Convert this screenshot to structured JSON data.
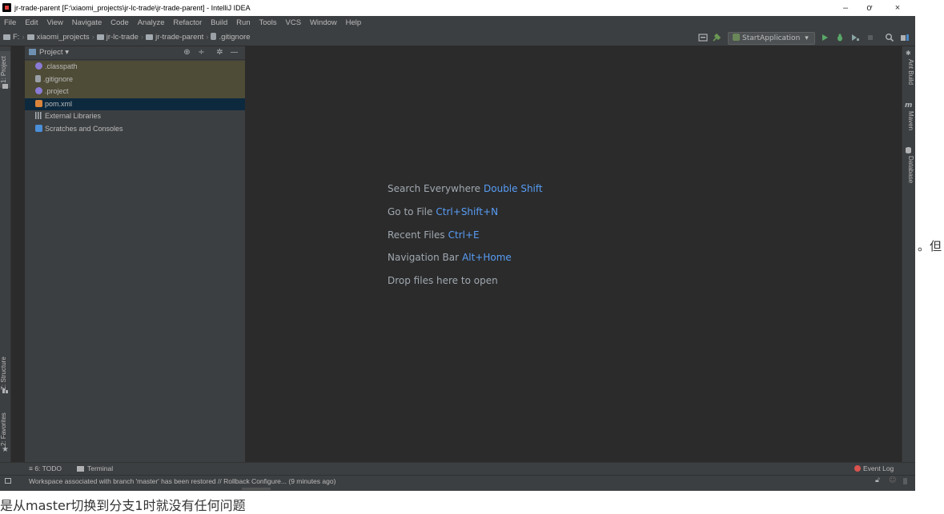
{
  "window": {
    "title": "jr-trade-parent [F:\\xiaomi_projects\\jr-lc-trade\\jr-trade-parent] - IntelliJ IDEA",
    "minimize": "–",
    "maximize": "ơ",
    "close": "×"
  },
  "menu": [
    "File",
    "Edit",
    "View",
    "Navigate",
    "Code",
    "Analyze",
    "Refactor",
    "Build",
    "Run",
    "Tools",
    "VCS",
    "Window",
    "Help"
  ],
  "breadcrumb": {
    "drive": "F:",
    "items": [
      "xiaomi_projects",
      "jr-lc-trade",
      "jr-trade-parent",
      ".gitignore"
    ]
  },
  "toolbar": {
    "run_config": "StartApplication"
  },
  "left_strip": {
    "project_tab": "1: Project",
    "structure_tab": "Z: Structure",
    "favorites_tab": "2: Favorites"
  },
  "right_strip": {
    "ant_tab": "Ant Build",
    "maven_tab": "Maven",
    "database_tab": "Database"
  },
  "project_panel": {
    "title": "Project",
    "items": [
      {
        "label": ".classpath",
        "state": "ignored",
        "icon": "classpath-file-icon",
        "color": "#8a7bd6"
      },
      {
        "label": ".gitignore",
        "state": "ignored",
        "icon": "gitignore-file-icon",
        "color": "#9aa0a6"
      },
      {
        "label": ".project",
        "state": "ignored",
        "icon": "project-file-icon",
        "color": "#8a7bd6"
      },
      {
        "label": "pom.xml",
        "state": "selected",
        "icon": "maven-pom-icon",
        "color": "#d9843a"
      },
      {
        "label": "External Libraries",
        "state": "normal",
        "icon": "libraries-icon",
        "color": "#a9b0b8"
      },
      {
        "label": "Scratches and Consoles",
        "state": "normal",
        "icon": "scratches-icon",
        "color": "#4a8fd8"
      }
    ]
  },
  "editor_hints": [
    {
      "label": "Search Everywhere",
      "shortcut": "Double Shift"
    },
    {
      "label": "Go to File",
      "shortcut": "Ctrl+Shift+N"
    },
    {
      "label": "Recent Files",
      "shortcut": "Ctrl+E"
    },
    {
      "label": "Navigation Bar",
      "shortcut": "Alt+Home"
    },
    {
      "label": "Drop files here to open",
      "shortcut": ""
    }
  ],
  "bottom_tabs": {
    "todo": "6: TODO",
    "terminal": "Terminal",
    "event_log": "Event Log"
  },
  "status": {
    "message": "Workspace associated with branch 'master' has been restored // Rollback Configure... (9 minutes ago)"
  },
  "outside_text": {
    "side_fragment": "。但",
    "bottom_fragment": "是从master切换到分支1时就没有任何问题"
  },
  "colors": {
    "ide_bg": "#2b2b2b",
    "panel_bg": "#3c3f41",
    "accent_key": "#589df6",
    "ignored_row": "#4e4b36",
    "selected_row": "#0d293e"
  }
}
